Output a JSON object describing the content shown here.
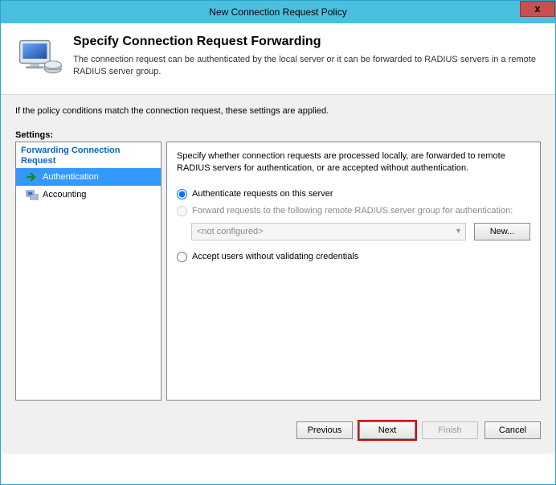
{
  "window": {
    "title": "New Connection Request Policy",
    "close_label": "x"
  },
  "header": {
    "heading": "Specify Connection Request Forwarding",
    "subheading": "The connection request can be authenticated by the local server or it can be forwarded to RADIUS servers in a remote RADIUS server group."
  },
  "hint": "If the policy conditions match the connection request, these settings are applied.",
  "settings_label": "Settings:",
  "tree": {
    "group_label": "Forwarding Connection Request",
    "items": [
      {
        "label": "Authentication",
        "selected": true
      },
      {
        "label": "Accounting",
        "selected": false
      }
    ]
  },
  "detail": {
    "description": "Specify whether connection requests are processed locally, are forwarded to remote RADIUS servers for authentication, or are accepted without authentication.",
    "option_local": "Authenticate requests on this server",
    "option_forward": "Forward requests to the following remote RADIUS server group for authentication:",
    "combo_value": "<not configured>",
    "new_button": "New...",
    "option_accept": "Accept users without validating credentials"
  },
  "buttons": {
    "previous": "Previous",
    "next": "Next",
    "finish": "Finish",
    "cancel": "Cancel"
  }
}
